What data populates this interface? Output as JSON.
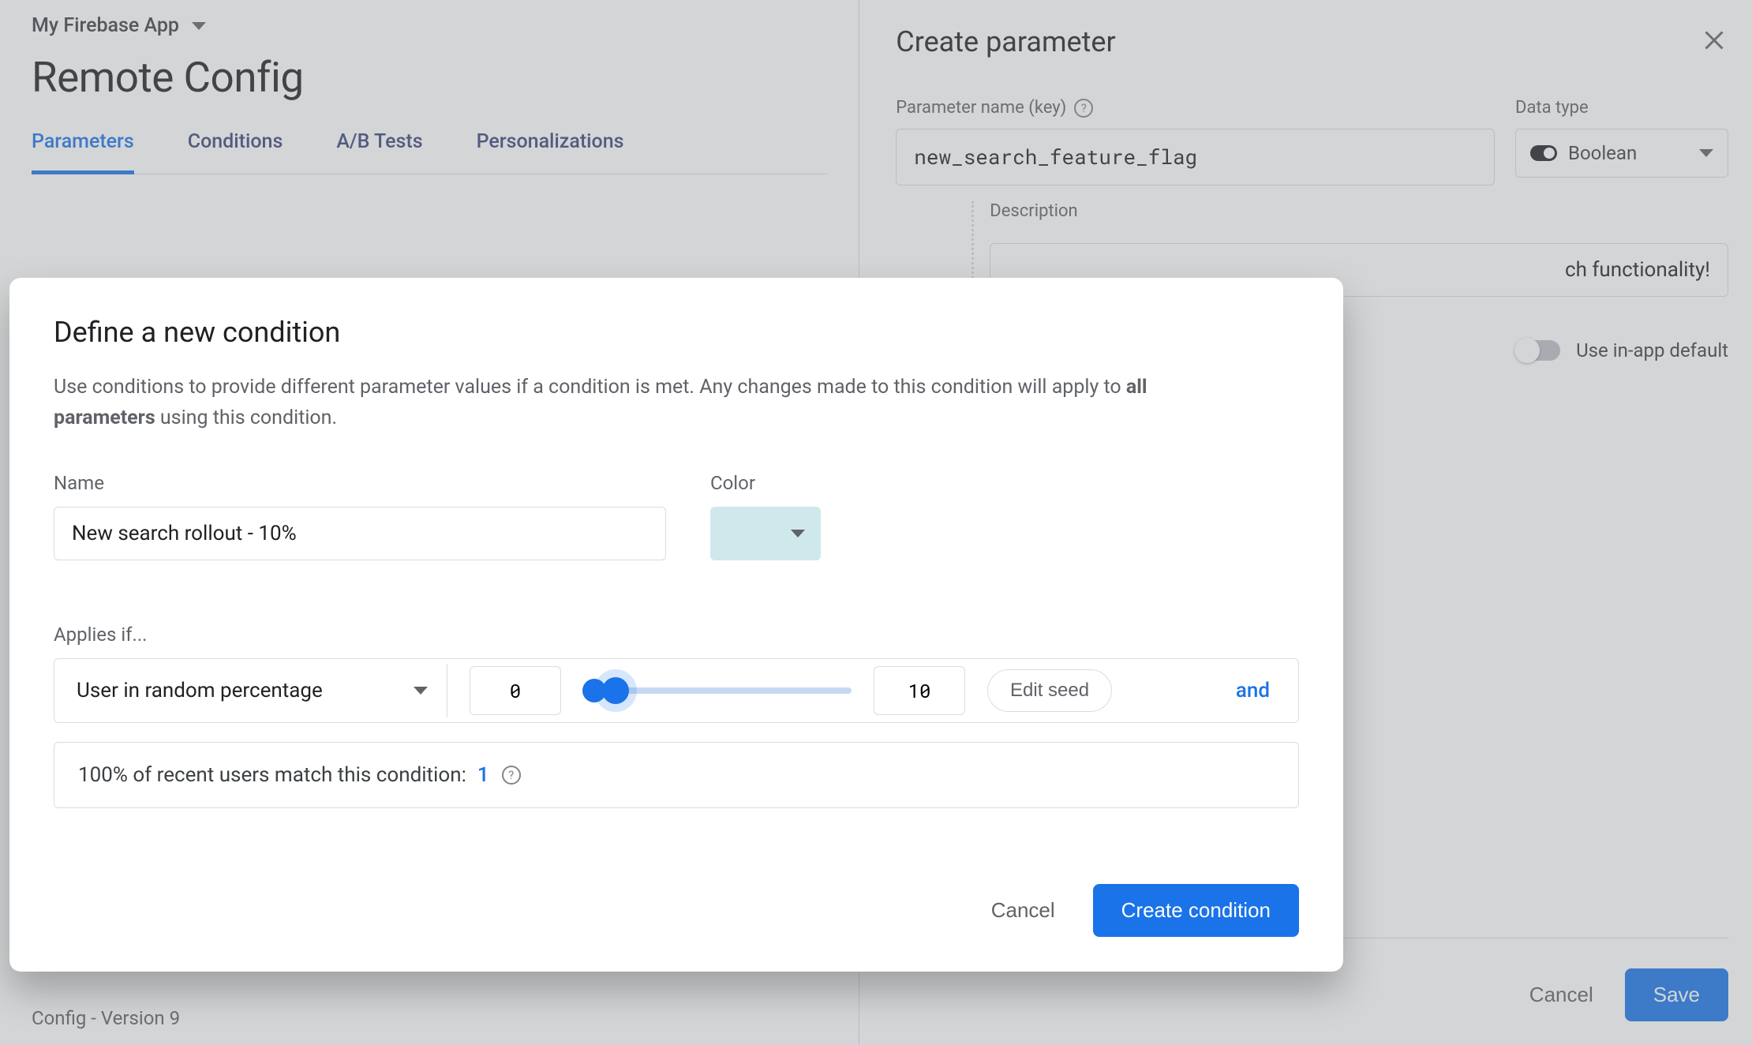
{
  "header": {
    "app_name": "My Firebase App",
    "page_title": "Remote Config"
  },
  "tabs": {
    "parameters": "Parameters",
    "conditions": "Conditions",
    "ab_tests": "A/B Tests",
    "personalizations": "Personalizations"
  },
  "footer": {
    "config_version": "Config - Version 9"
  },
  "right_panel": {
    "title": "Create parameter",
    "param_key_label": "Parameter name (key)",
    "param_key_value": "new_search_feature_flag",
    "data_type_label": "Data type",
    "data_type_value": "Boolean",
    "description_label": "Description",
    "description_value_fragment": "ch functionality!",
    "use_default_label": "Use in-app default",
    "cancel": "Cancel",
    "save": "Save"
  },
  "modal": {
    "title": "Define a new condition",
    "description_pre": "Use conditions to provide different parameter values if a condition is met. Any changes made to this condition will apply to ",
    "description_strong": "all parameters",
    "description_post": " using this condition.",
    "name_label": "Name",
    "name_value": "New search rollout - 10%",
    "color_label": "Color",
    "color_hex": "#cfe8ec",
    "applies_label": "Applies if...",
    "rule_type": "User in random percentage",
    "range_start": "0",
    "range_end": "10",
    "edit_seed": "Edit seed",
    "and": "and",
    "match_text_pre": "100% of recent users match this condition: ",
    "match_count": "1",
    "cancel": "Cancel",
    "create": "Create condition"
  }
}
